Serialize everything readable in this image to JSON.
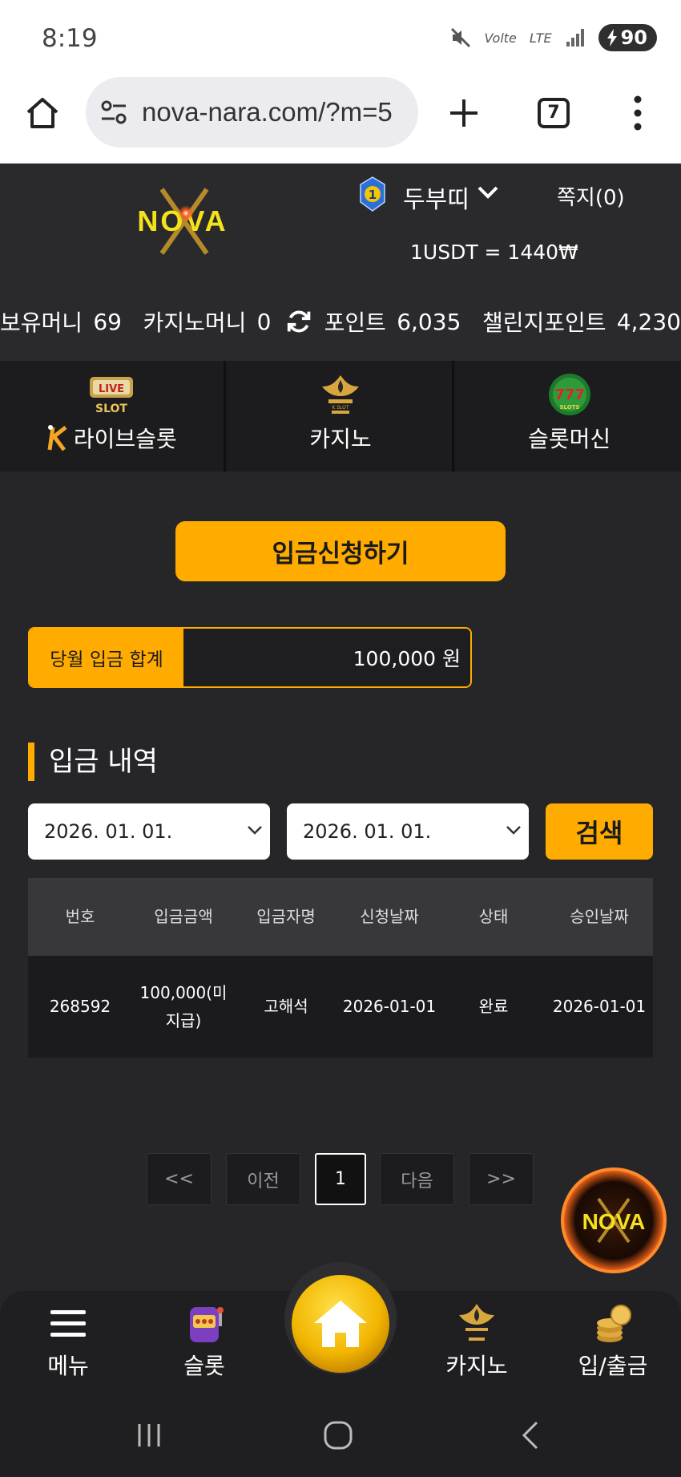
{
  "status_bar": {
    "time": "8:19",
    "network_label": "LTE",
    "volte_label": "Vo",
    "battery": "90",
    "icons": [
      "mute-icon",
      "volte-icon",
      "lte-icon",
      "signal-icon",
      "battery-charging-icon"
    ]
  },
  "browser": {
    "url": "nova-nara.com/?m=5",
    "tab_count": "7",
    "icons": [
      "home-icon",
      "site-settings-icon",
      "new-tab-icon",
      "tabs-icon",
      "more-options-icon"
    ]
  },
  "header": {
    "logo_text": "NOVA",
    "user_level": "1",
    "username": "두부띠",
    "messages": "쪽지(0)",
    "exchange_rate": "1USDT = 1440₩"
  },
  "balances": {
    "held_money_label": "보유머니",
    "held_money": "69",
    "casino_money_label": "카지노머니",
    "casino_money": "0",
    "points_label": "포인트",
    "points": "6,035",
    "challenge_points_label": "챌린지포인트",
    "challenge_points": "4,230"
  },
  "categories": [
    {
      "label": "라이브슬롯",
      "icon": "live-slot-icon"
    },
    {
      "label": "카지노",
      "icon": "casino-icon"
    },
    {
      "label": "슬롯머신",
      "icon": "slot-machine-icon"
    }
  ],
  "deposit": {
    "request_button": "입금신청하기",
    "monthly_total_label": "당월 입금 합계",
    "monthly_total_value": "100,000 원"
  },
  "history": {
    "title": "입금 내역",
    "date_from": "2026. 01. 01.",
    "date_to": "2026. 01. 01.",
    "search_button": "검색",
    "columns": [
      "번호",
      "입금금액",
      "입금자명",
      "신청날짜",
      "상태",
      "승인날짜"
    ],
    "rows": [
      [
        "268592",
        "100,000(미지급)",
        "고해석",
        "2026-01-01",
        "완료",
        "2026-01-01"
      ]
    ]
  },
  "pagination": {
    "first": "<<",
    "prev": "이전",
    "current": "1",
    "next": "다음",
    "last": ">>"
  },
  "bottom_nav": {
    "menu": "메뉴",
    "slot": "슬롯",
    "casino": "카지노",
    "deposit_withdraw": "입/출금"
  },
  "colors": {
    "accent": "#ffab00",
    "background": "#262629",
    "header": "#2a2a2d"
  }
}
